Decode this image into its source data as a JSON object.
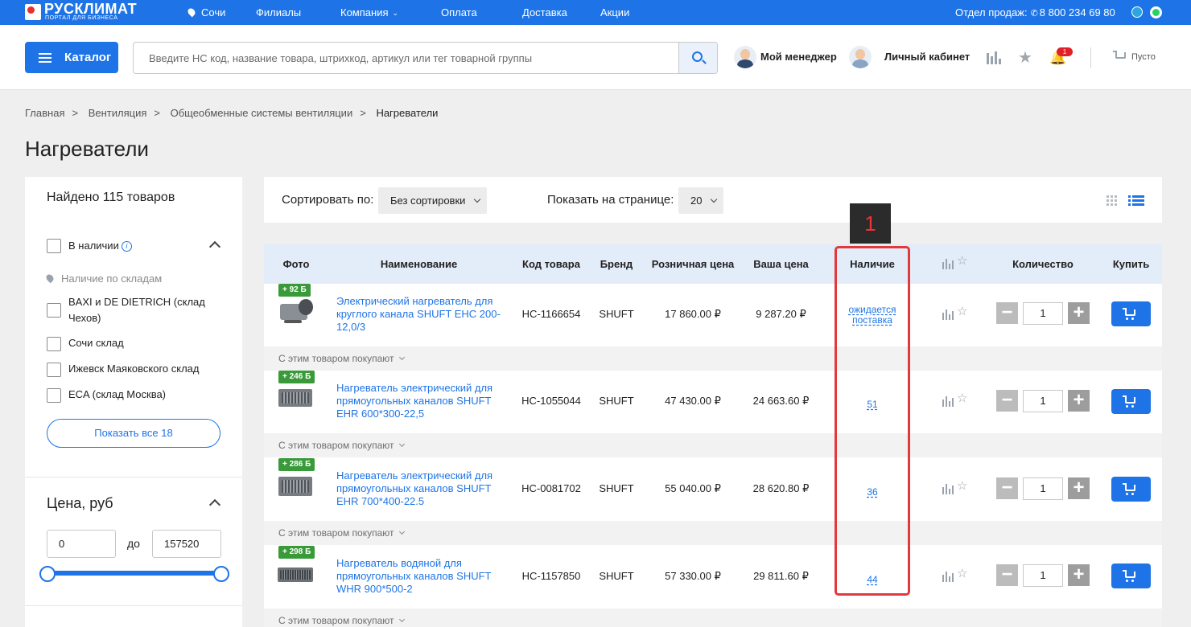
{
  "topbar": {
    "brand_name": "РУСКЛИМАТ",
    "brand_sub": "ПОРТАЛ ДЛЯ БИЗНЕСА",
    "city": "Сочи",
    "nav": [
      "Филиалы",
      "Компания",
      "Оплата",
      "Доставка",
      "Акции"
    ],
    "sales_label": "Отдел продаж:",
    "phone": "8 800 234 69 80",
    "colors": {
      "bar": "#1e74e6",
      "telegram": "#2ca5e0",
      "whatsapp": "#25d366"
    }
  },
  "header": {
    "catalog_label": "Каталог",
    "search_placeholder": "Введите НС код, название товара, штрихкод, артикул или тег товарной группы",
    "manager_label": "Мой менеджер",
    "cabinet_label": "Личный кабинет",
    "notifications_count": "1",
    "cart_label": "Пусто"
  },
  "breadcrumb": [
    "Главная",
    "Вентиляция",
    "Общеобменные системы вентиляции",
    "Нагреватели"
  ],
  "page_title": "Нагреватели",
  "sidebar": {
    "found": "Найдено 115 товаров",
    "in_stock_label": "В наличии",
    "stock_hint": "Наличие по складам",
    "warehouses": [
      "BAXI и DE DIETRICH (склад Чехов)",
      "Сочи склад",
      "Ижевск Маяковского склад",
      "ECA (склад Москва)"
    ],
    "show_all": "Показать все 18",
    "price_title": "Цена, руб",
    "price_from": "0",
    "price_to_label": "до",
    "price_to": "157520"
  },
  "toolbar": {
    "sort_label": "Сортировать по:",
    "sort_value": "Без сортировки",
    "per_page_label": "Показать на странице:",
    "per_page_value": "20"
  },
  "annotation_label": "1",
  "table": {
    "columns": [
      "Фото",
      "Наименование",
      "Код товара",
      "Бренд",
      "Розничная цена",
      "Ваша цена",
      "Наличие",
      "Количество",
      "Купить"
    ],
    "also_bought_label": "С этим товаром покупают",
    "rows": [
      {
        "bonus": "+ 92 Б",
        "name": "Электрический нагреватель для круглого канала SHUFT EHC 200-12,0/3",
        "code": "НС-1166654",
        "brand": "SHUFT",
        "retail": "17 860.00 ₽",
        "price": "9 287.20 ₽",
        "availability": "ожидается поставка",
        "qty": "1"
      },
      {
        "bonus": "+ 246 Б",
        "name": "Нагреватель электрический для прямоугольных каналов SHUFT EHR 600*300-22,5",
        "code": "НС-1055044",
        "brand": "SHUFT",
        "retail": "47 430.00 ₽",
        "price": "24 663.60 ₽",
        "availability": "51",
        "qty": "1"
      },
      {
        "bonus": "+ 286 Б",
        "name": "Нагреватель электрический для прямоугольных каналов SHUFT EHR 700*400-22.5",
        "code": "НС-0081702",
        "brand": "SHUFT",
        "retail": "55 040.00 ₽",
        "price": "28 620.80 ₽",
        "availability": "36",
        "qty": "1"
      },
      {
        "bonus": "+ 298 Б",
        "name": "Нагреватель водяной для прямоугольных каналов SHUFT WHR 900*500-2",
        "code": "НС-1157850",
        "brand": "SHUFT",
        "retail": "57 330.00 ₽",
        "price": "29 811.60 ₽",
        "availability": "44",
        "qty": "1"
      }
    ]
  }
}
